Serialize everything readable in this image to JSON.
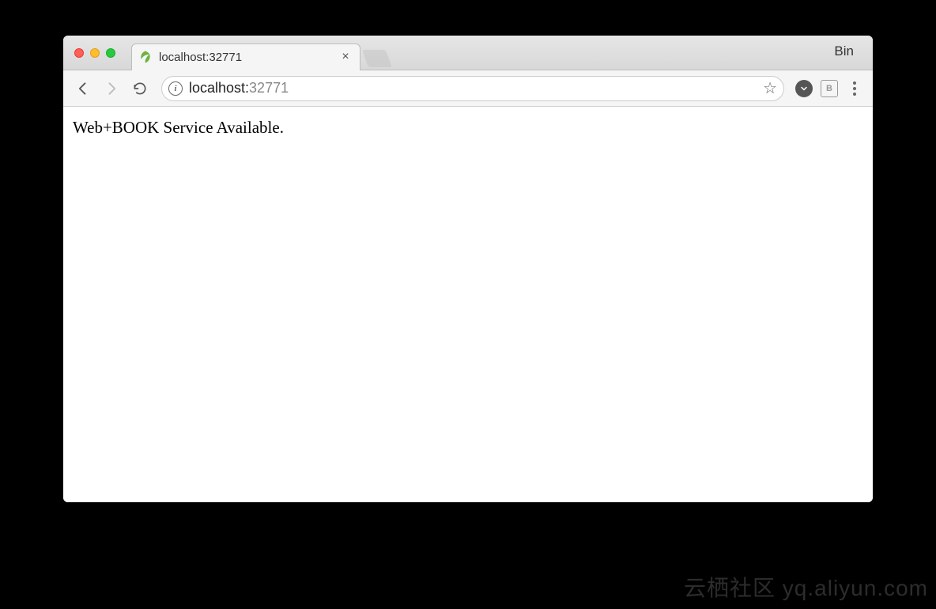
{
  "window": {
    "profile_label": "Bin",
    "tab": {
      "title": "localhost:32771",
      "favicon": "spring-leaf-icon"
    }
  },
  "toolbar": {
    "url_host": "localhost:",
    "url_port": "32771"
  },
  "page": {
    "body_text": "Web+BOOK Service Available."
  },
  "watermark": {
    "text": "云栖社区 yq.aliyun.com"
  }
}
